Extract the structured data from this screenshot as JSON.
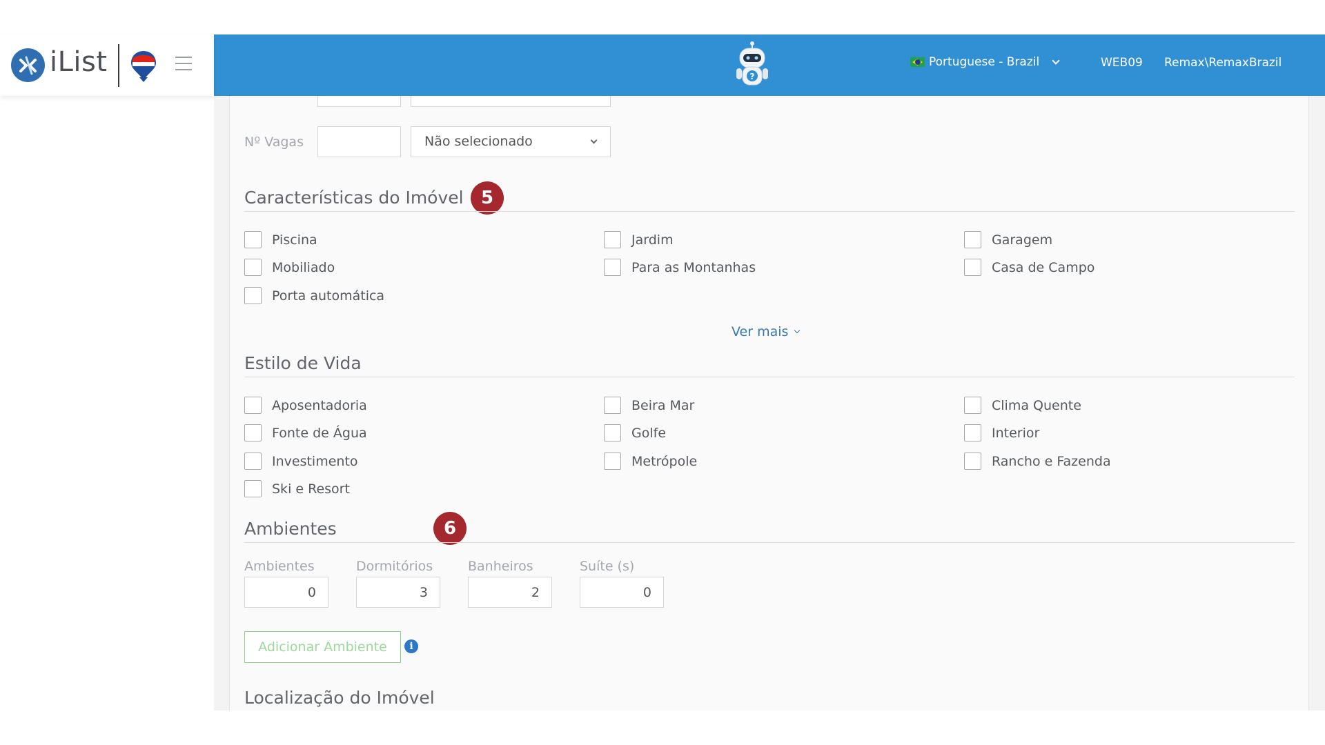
{
  "brand": {
    "logo_text": "iList"
  },
  "header": {
    "language": "Portuguese - Brazil",
    "user_code": "WEB09",
    "user_name": "Remax\\RemaxBrazil"
  },
  "parking": {
    "label": "Nº Vagas",
    "select_value": "Não selecionado"
  },
  "features": {
    "title": "Características do Imóvel",
    "badge": "5",
    "items": [
      "Piscina",
      "Jardim",
      "Garagem",
      "Mobiliado",
      "Para as Montanhas",
      "Casa de Campo",
      "Porta automática"
    ],
    "see_more": "Ver mais"
  },
  "lifestyle": {
    "title": "Estilo de Vida",
    "items": [
      "Aposentadoria",
      "Beira Mar",
      "Clima Quente",
      "Fonte de Água",
      "Golfe",
      "Interior",
      "Investimento",
      "Metrópole",
      "Rancho e Fazenda",
      "Ski e Resort"
    ]
  },
  "rooms": {
    "title": "Ambientes",
    "badge": "6",
    "fields": [
      {
        "label": "Ambientes",
        "value": "0"
      },
      {
        "label": "Dormitórios",
        "value": "3"
      },
      {
        "label": "Banheiros",
        "value": "2"
      },
      {
        "label": "Suíte (s)",
        "value": "0"
      }
    ],
    "add_button": "Adicionar Ambiente",
    "info_glyph": "i"
  },
  "location": {
    "title": "Localização do Imóvel"
  }
}
